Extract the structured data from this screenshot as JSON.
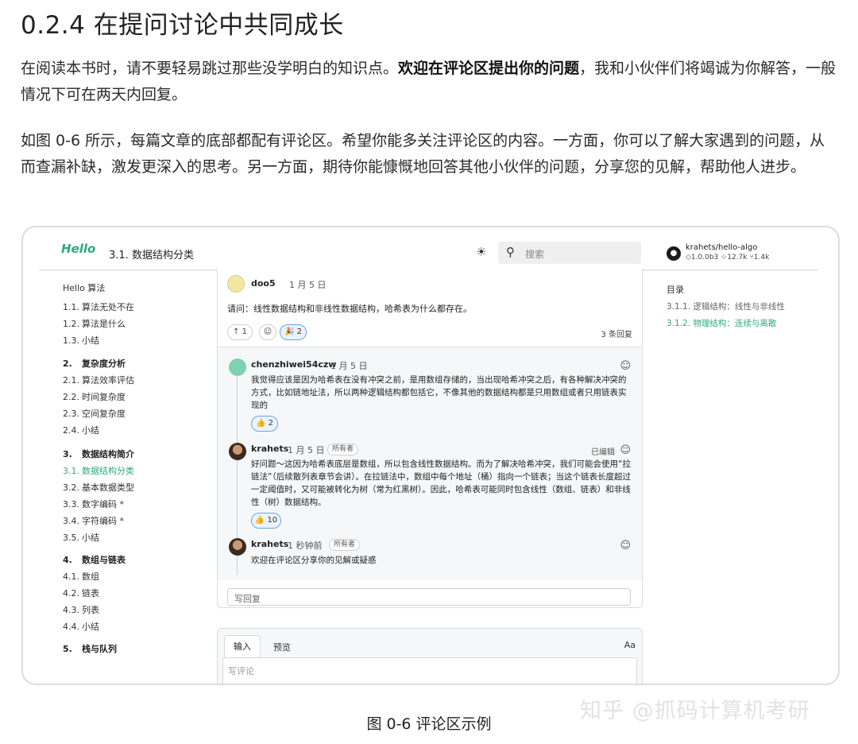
{
  "heading": "0.2.4   在提问讨论中共同成长",
  "para1": {
    "before": "在阅读本书时，请不要轻易跳过那些没学明白的知识点。",
    "bold": "欢迎在评论区提出你的问题",
    "after": "，我和小伙伴们将竭诚为你解答，一般情况下可在两天内回复。"
  },
  "para2": "如图 0-6 所示，每篇文章的底部都配有评论区。希望你能多关注评论区的内容。一方面，你可以了解大家遇到的问题，从而查漏补缺，激发更深入的思考。另一方面，期待你能慷慨地回答其他小伙伴的问题，分享您的见解，帮助他人进步。",
  "screenshot": {
    "header": {
      "logo_text": "Hello",
      "page_title": "3.1.  数据结构分类",
      "search_placeholder": "搜索",
      "repo_name": "krahets/hello-algo",
      "repo_version": "1.0.0b3",
      "repo_stars": "12.7k",
      "repo_forks": "1.4k"
    },
    "nav": {
      "home": "Hello 算法",
      "items": [
        {
          "num": "1.1.",
          "label": "算法无处不在"
        },
        {
          "num": "1.2.",
          "label": "算法是什么"
        },
        {
          "num": "1.3.",
          "label": "小结"
        },
        {
          "num": "2.",
          "label": "复杂度分析"
        },
        {
          "num": "2.1.",
          "label": "算法效率评估"
        },
        {
          "num": "2.2.",
          "label": "时间复杂度"
        },
        {
          "num": "2.3.",
          "label": "空间复杂度"
        },
        {
          "num": "2.4.",
          "label": "小结"
        },
        {
          "num": "3.",
          "label": "数据结构简介"
        },
        {
          "num": "3.1.",
          "label": "数据结构分类"
        },
        {
          "num": "3.2.",
          "label": "基本数据类型"
        },
        {
          "num": "3.3.",
          "label": "数字编码 *"
        },
        {
          "num": "3.4.",
          "label": "字符编码 *"
        },
        {
          "num": "3.5.",
          "label": "小结"
        },
        {
          "num": "4.",
          "label": "数组与链表"
        },
        {
          "num": "4.1.",
          "label": "数组"
        },
        {
          "num": "4.2.",
          "label": "链表"
        },
        {
          "num": "4.3.",
          "label": "列表"
        },
        {
          "num": "4.4.",
          "label": "小结"
        },
        {
          "num": "5.",
          "label": "栈与队列"
        }
      ]
    },
    "question": {
      "author": "doo5",
      "date": "1 月 5 日",
      "body": "请问：线性数据结构和非线性数据结构，哈希表为什么都存在。",
      "upvote": "↑ 1",
      "reaction": "🎉 2",
      "replies": "3 条回复"
    },
    "comments": [
      {
        "author": "chenzhiwei54czw",
        "date": "1 月 5 日",
        "body": "我觉得应该是因为哈希表在没有冲突之前，是用数组存储的，当出现哈希冲突之后，有各种解决冲突的方式，比如链地址法，所以两种逻辑结构都包括它，不像其他的数据结构都是只用数组或者只用链表实现的",
        "reaction": "👍 2"
      },
      {
        "author": "krahets",
        "date": "1 月 5 日",
        "badge": "所有者",
        "edited": "已编辑",
        "body": "好问题～这因为哈希表底层是数组，所以包含线性数据结构。而为了解决哈希冲突，我们可能会使用“拉链法”（后续散列表章节会讲）。在拉链法中，数组中每个地址（桶）指向一个链表；当这个链表长度超过一定阈值时，又可能被转化为树（常为红黑树）。因此，哈希表可能同时包含线性（数组、链表）和非线性（树）数据结构。",
        "reaction": "👍 10"
      },
      {
        "author": "krahets",
        "date": "1 秒钟前",
        "badge": "所有者",
        "body": "欢迎在评论区分享你的见解或疑惑"
      }
    ],
    "reply_placeholder": "写回复",
    "comment_box": {
      "tab_input": "输入",
      "tab_preview": "预览",
      "aa": "Aa",
      "placeholder": "写评论"
    },
    "toc": {
      "title": "目录",
      "items": [
        "3.1.1.  逻辑结构：线性与非线性",
        "3.1.2.  物理结构：连续与离散"
      ]
    }
  },
  "caption": "图 0-6   评论区示例",
  "watermark": "知乎 @抓码计算机考研",
  "colors": {
    "accent_green": "#2faa7a",
    "reaction_blue": "#69a4e8"
  }
}
